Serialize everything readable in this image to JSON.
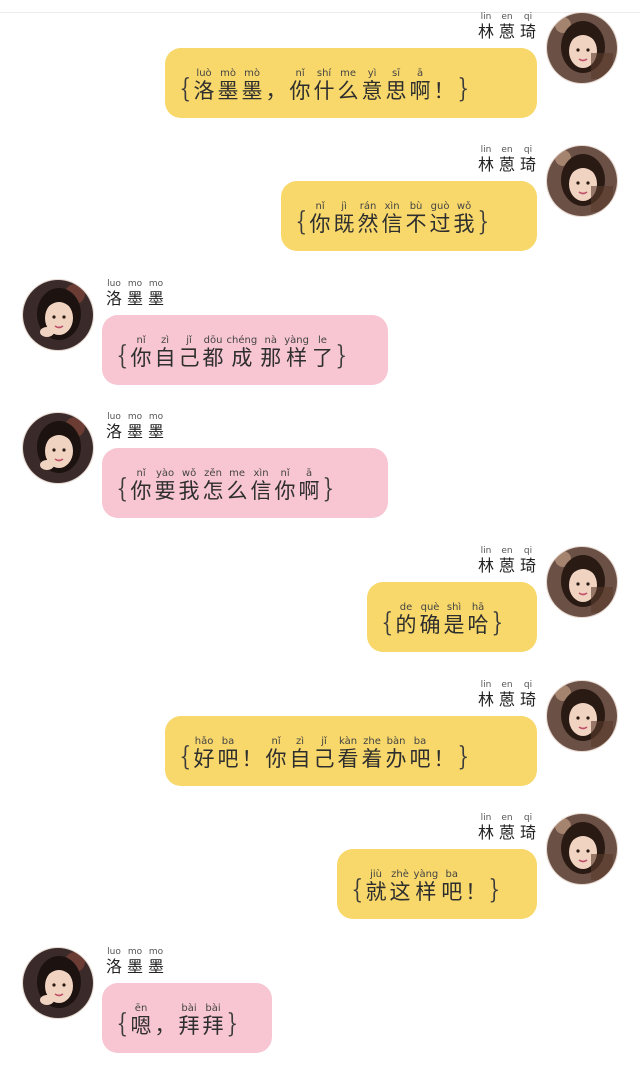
{
  "senders": {
    "right": {
      "name": [
        [
          "林",
          "lin"
        ],
        [
          "蒽",
          "en"
        ],
        [
          "琦",
          "qi"
        ]
      ]
    },
    "left": {
      "name": [
        [
          "洛",
          "luo"
        ],
        [
          "墨",
          "mo"
        ],
        [
          "墨",
          "mo"
        ]
      ]
    }
  },
  "messages": [
    {
      "side": "right",
      "show_name": "true",
      "chars": [
        [
          "洛",
          "luò"
        ],
        [
          "墨",
          "mò"
        ],
        [
          "墨",
          "mò"
        ],
        [
          "，",
          ""
        ],
        [
          "你",
          "nǐ"
        ],
        [
          "什",
          "shí"
        ],
        [
          "么",
          "me"
        ],
        [
          "意",
          "yì"
        ],
        [
          "思",
          "sī"
        ],
        [
          "啊",
          "ā"
        ],
        [
          "！",
          ""
        ]
      ]
    },
    {
      "side": "right",
      "show_name": "true",
      "chars": [
        [
          "你",
          "nǐ"
        ],
        [
          "既",
          "jì"
        ],
        [
          "然",
          "rán"
        ],
        [
          "信",
          "xìn"
        ],
        [
          "不",
          "bù"
        ],
        [
          "过",
          "guò"
        ],
        [
          "我",
          "wǒ"
        ]
      ]
    },
    {
      "side": "left",
      "show_name": "true",
      "chars": [
        [
          "你",
          "nǐ"
        ],
        [
          "自",
          "zì"
        ],
        [
          "己",
          "jǐ"
        ],
        [
          "都",
          "dōu"
        ],
        [
          "成",
          "chéng"
        ],
        [
          "那",
          "nà"
        ],
        [
          "样",
          "yàng"
        ],
        [
          "了",
          "le"
        ]
      ]
    },
    {
      "side": "left",
      "show_name": "true",
      "chars": [
        [
          "你",
          "nǐ"
        ],
        [
          "要",
          "yào"
        ],
        [
          "我",
          "wǒ"
        ],
        [
          "怎",
          "zěn"
        ],
        [
          "么",
          "me"
        ],
        [
          "信",
          "xìn"
        ],
        [
          "你",
          "nǐ"
        ],
        [
          "啊",
          "ā"
        ]
      ]
    },
    {
      "side": "right",
      "show_name": "true",
      "chars": [
        [
          "的",
          "de"
        ],
        [
          "确",
          "què"
        ],
        [
          "是",
          "shì"
        ],
        [
          "哈",
          "hā"
        ]
      ]
    },
    {
      "side": "right",
      "show_name": "true",
      "chars": [
        [
          "好",
          "hǎo"
        ],
        [
          "吧",
          "ba"
        ],
        [
          "！",
          ""
        ],
        [
          "你",
          "nǐ"
        ],
        [
          "自",
          "zì"
        ],
        [
          "己",
          "jǐ"
        ],
        [
          "看",
          "kàn"
        ],
        [
          "着",
          "zhe"
        ],
        [
          "办",
          "bàn"
        ],
        [
          "吧",
          "ba"
        ],
        [
          "！",
          ""
        ]
      ]
    },
    {
      "side": "right",
      "show_name": "true",
      "chars": [
        [
          "就",
          "jiù"
        ],
        [
          "这",
          "zhè"
        ],
        [
          "样",
          "yàng"
        ],
        [
          "吧",
          "ba"
        ],
        [
          "！",
          ""
        ]
      ]
    },
    {
      "side": "left",
      "show_name": "true",
      "chars": [
        [
          "嗯",
          "ēn"
        ],
        [
          "，",
          ""
        ],
        [
          "拜",
          "bài"
        ],
        [
          "拜",
          "bài"
        ]
      ]
    }
  ],
  "braces": {
    "open": "{",
    "close": "}"
  },
  "colors": {
    "right_bubble": "#f8d86b",
    "left_bubble": "#f7c6d2",
    "background": "#ffffff"
  }
}
